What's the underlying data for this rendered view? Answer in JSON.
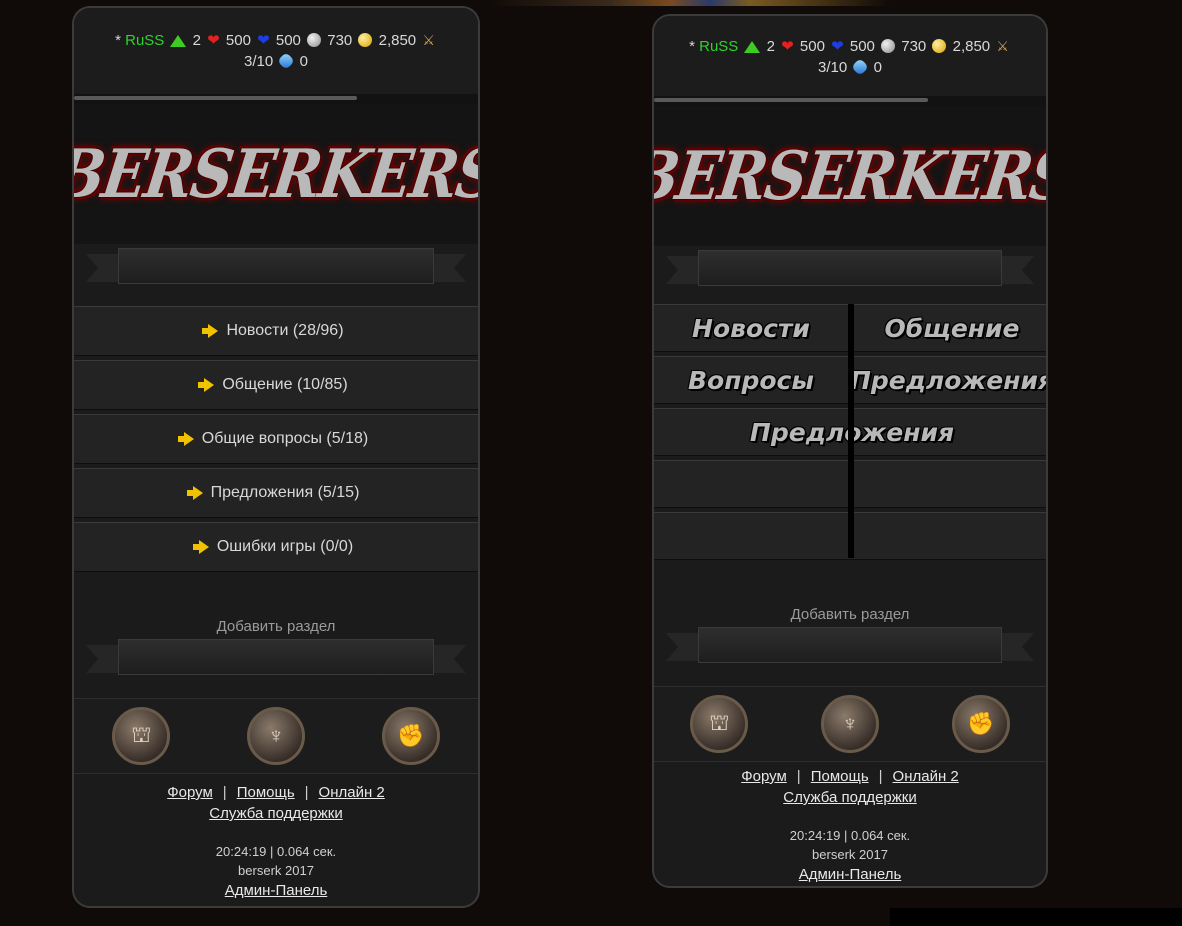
{
  "left": {
    "stats": {
      "star": "*",
      "user": "RuSS",
      "level": "2",
      "hp": "500",
      "mana": "500",
      "silver": "730",
      "gold": "2,850",
      "battles": "3/10",
      "crystals": "0"
    },
    "progress_fraction": 0.7,
    "logo": "Berserkers",
    "menu": [
      {
        "label": "Новости (28/96)"
      },
      {
        "label": "Общение (10/85)"
      },
      {
        "label": "Общие вопросы (5/18)"
      },
      {
        "label": "Предложения (5/15)"
      },
      {
        "label": "Ошибки игры (0/0)"
      }
    ],
    "add_section": "Добавить раздел",
    "footer": {
      "forum": "Форум",
      "help": "Помощь",
      "online": "Онлайн 2",
      "support": "Служба поддержки",
      "time": "20:24:19 | 0.064 сек.",
      "copyright": "berserk 2017",
      "admin": "Админ-Панель"
    }
  },
  "right": {
    "stats": {
      "star": "*",
      "user": "RuSS",
      "level": "2",
      "hp": "500",
      "mana": "500",
      "silver": "730",
      "gold": "2,850",
      "battles": "3/10",
      "crystals": "0"
    },
    "progress_fraction": 0.7,
    "logo": "Berserkers",
    "buttons": {
      "news": "Новости",
      "chat": "Общение",
      "questions": "Вопросы",
      "proposals_right": "Предложения",
      "proposals_center": "Предложения"
    },
    "add_section": "Добавить раздел",
    "footer": {
      "forum": "Форум",
      "help": "Помощь",
      "online": "Онлайн 2",
      "support": "Служба поддержки",
      "time": "20:24:19 | 0.064 сек.",
      "copyright": "berserk 2017",
      "admin": "Админ-Панель"
    }
  },
  "icons": [
    "up-arrow-icon",
    "heart-icon",
    "blue-heart-icon",
    "silver-coin-icon",
    "gold-coin-icon",
    "crossed-swords-icon",
    "crystal-icon",
    "fortress-emblem-icon",
    "warrior-emblem-icon",
    "fist-emblem-icon"
  ],
  "colors": {
    "username": "#2ed12e",
    "arrow": "#f2c200",
    "background": "#100b08",
    "panel": "#1b1b1b"
  }
}
